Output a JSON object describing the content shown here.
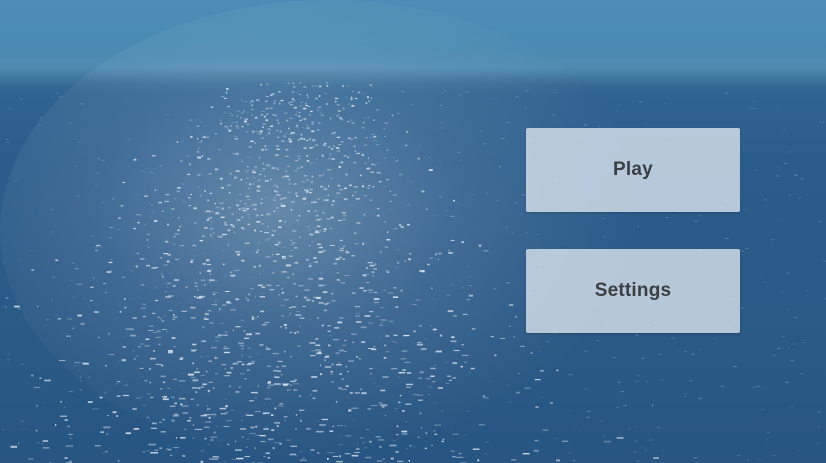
{
  "background": {
    "scene": "ocean-water-with-sun-glare"
  },
  "menu": {
    "play_label": "Play",
    "settings_label": "Settings"
  },
  "colors": {
    "sky": "#4d8db5",
    "water": "#2a5a88",
    "button_fill": "#d6e0ea",
    "button_text": "#3a3f44"
  }
}
